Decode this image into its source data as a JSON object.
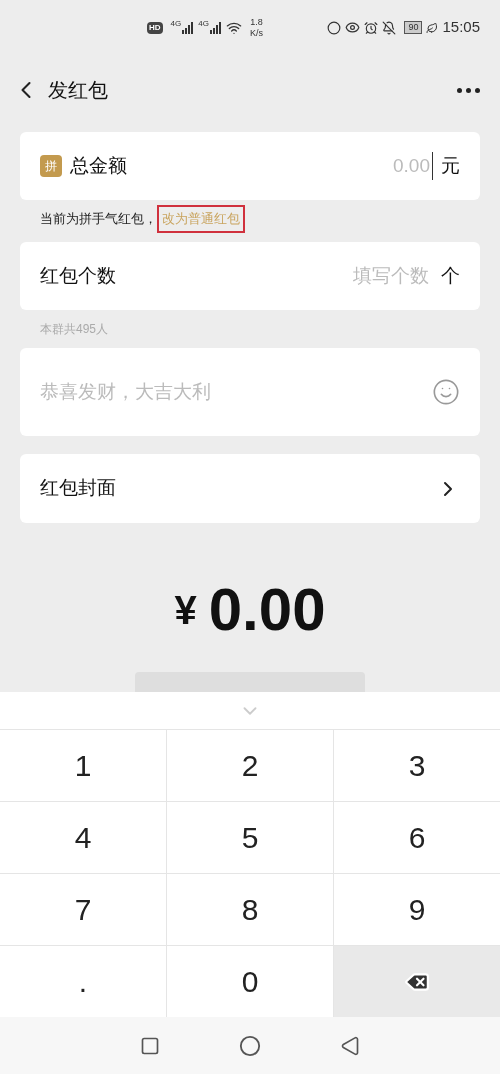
{
  "status_bar": {
    "hd": "HD",
    "network_1": "4G",
    "network_2": "4G",
    "speed_value": "1.8",
    "speed_unit": "K/s",
    "battery": "90",
    "time": "15:05"
  },
  "header": {
    "title": "发红包"
  },
  "amount_card": {
    "badge": "拼",
    "label": "总金额",
    "placeholder": "0.00",
    "unit": "元"
  },
  "type_note": {
    "text": "当前为拼手气红包，",
    "link": "改为普通红包",
    "highlighted": true
  },
  "count_card": {
    "label": "红包个数",
    "placeholder": "填写个数",
    "unit": "个"
  },
  "count_note": "本群共495人",
  "message_card": {
    "placeholder": "恭喜发财，大吉大利"
  },
  "cover_row": {
    "label": "红包封面"
  },
  "total": {
    "currency": "¥",
    "amount": "0.00"
  },
  "keypad": {
    "keys": [
      {
        "kind": "digit",
        "label": "1"
      },
      {
        "kind": "digit",
        "label": "2"
      },
      {
        "kind": "digit",
        "label": "3"
      },
      {
        "kind": "digit",
        "label": "4"
      },
      {
        "kind": "digit",
        "label": "5"
      },
      {
        "kind": "digit",
        "label": "6"
      },
      {
        "kind": "digit",
        "label": "7"
      },
      {
        "kind": "digit",
        "label": "8"
      },
      {
        "kind": "digit",
        "label": "9"
      },
      {
        "kind": "digit",
        "label": "."
      },
      {
        "kind": "digit",
        "label": "0"
      },
      {
        "kind": "delete"
      }
    ]
  }
}
